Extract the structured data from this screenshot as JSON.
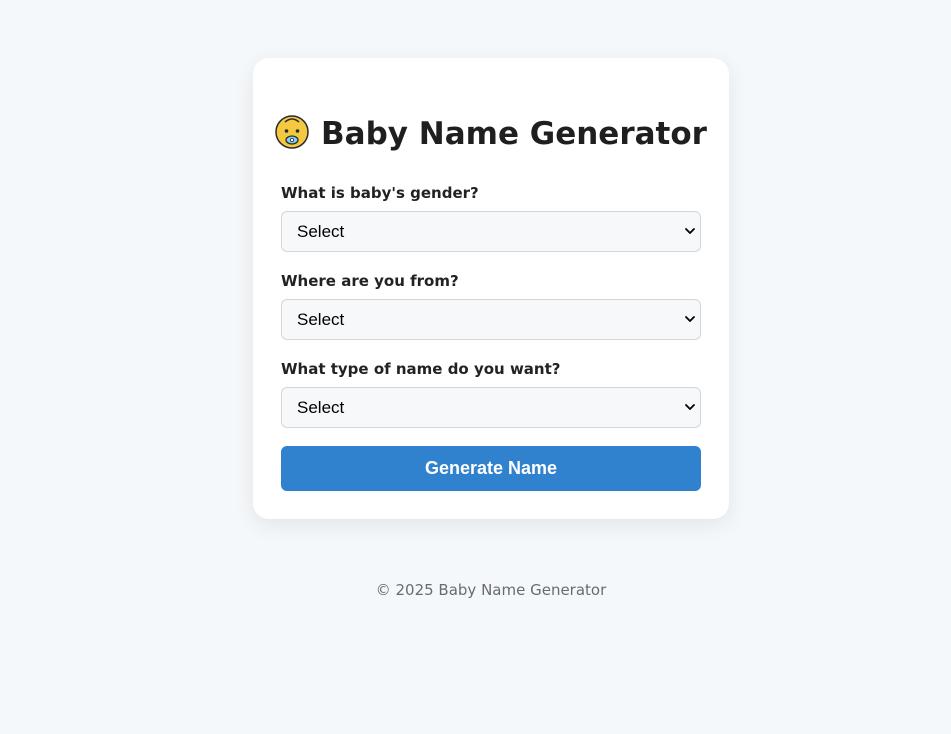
{
  "header": {
    "title": "Baby Name Generator",
    "icon": "baby-face-icon"
  },
  "form": {
    "fields": [
      {
        "label": "What is baby's gender?",
        "selected": "Select"
      },
      {
        "label": "Where are you from?",
        "selected": "Select"
      },
      {
        "label": "What type of name do you want?",
        "selected": "Select"
      }
    ],
    "submit_label": "Generate Name"
  },
  "footer": {
    "text": "© 2025 Baby Name Generator"
  },
  "colors": {
    "background": "#f5f8fb",
    "card": "#ffffff",
    "button": "#3182ce",
    "button_text": "#ffffff"
  }
}
